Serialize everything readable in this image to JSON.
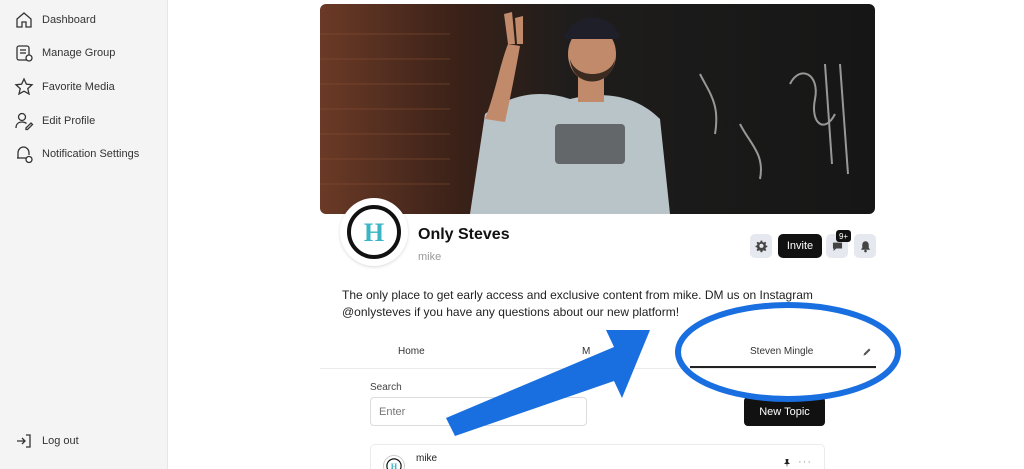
{
  "sidebar": {
    "items": [
      {
        "label": "Dashboard",
        "icon": "home-icon"
      },
      {
        "label": "Manage Group",
        "icon": "manage-group-icon"
      },
      {
        "label": "Favorite Media",
        "icon": "star-icon"
      },
      {
        "label": "Edit Profile",
        "icon": "user-edit-icon"
      },
      {
        "label": "Notification Settings",
        "icon": "notification-settings-icon"
      }
    ],
    "logout_label": "Log out"
  },
  "group": {
    "title": "Only Steves",
    "owner": "mike",
    "logo_letter": "H",
    "description": "The only place to get early access and exclusive content from mike. DM us on Instagram @onlysteves if you have any questions about our new platform!"
  },
  "actions": {
    "invite_label": "Invite",
    "chat_badge": "9+"
  },
  "tabs": {
    "home": "Home",
    "partial": "M",
    "active": "Steven Mingle"
  },
  "search": {
    "label": "Search",
    "placeholder": "Enter",
    "value": ""
  },
  "new_topic_label": "New Topic",
  "post": {
    "author": "mike",
    "more": "···"
  },
  "colors": {
    "accent": "#111111",
    "annotation_blue": "#1a6fe0",
    "sidebar_bg": "#f4f4f4",
    "logo_teal": "#3ab5c6"
  }
}
